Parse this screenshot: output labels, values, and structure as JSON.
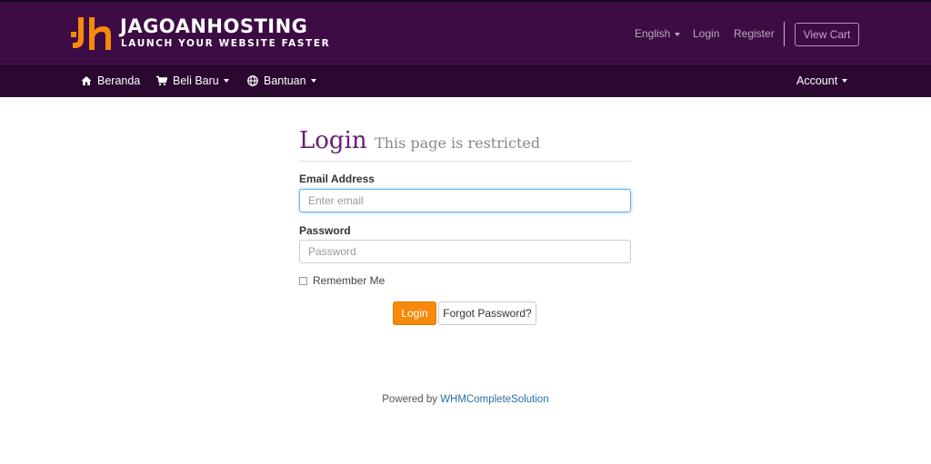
{
  "brand": {
    "name": "JAGOANHOSTING",
    "tagline": "LAUNCH YOUR WEBSITE FASTER",
    "logo_icon": "jh-logo-icon",
    "accent_color": "#f7890c",
    "header_color": "#3e0c44"
  },
  "topbar": {
    "language": "English",
    "login": "Login",
    "register": "Register",
    "view_cart": "View Cart"
  },
  "navbar": {
    "items": [
      {
        "label": "Beranda",
        "icon": "home-icon"
      },
      {
        "label": "Beli Baru",
        "icon": "cart-icon"
      },
      {
        "label": "Bantuan",
        "icon": "globe-icon"
      }
    ],
    "account": "Account"
  },
  "login_form": {
    "title": "Login",
    "subtitle": "This page is restricted",
    "email_label": "Email Address",
    "email_placeholder": "Enter email",
    "password_label": "Password",
    "password_placeholder": "Password",
    "remember_label": "Remember Me",
    "submit_label": "Login",
    "forgot_label": "Forgot Password?"
  },
  "footer": {
    "powered_by": "Powered by",
    "link_text": "WHMCompleteSolution"
  }
}
